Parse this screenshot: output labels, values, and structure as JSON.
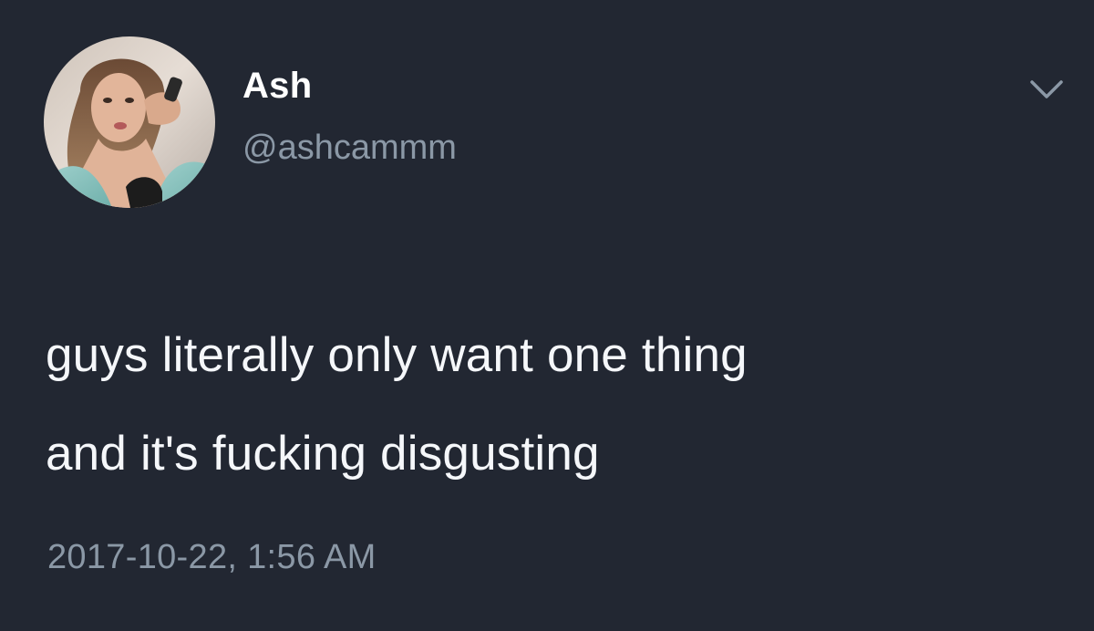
{
  "author": {
    "display_name": "Ash",
    "handle": "@ashcammm",
    "avatar_icon": "profile-photo"
  },
  "tweet": {
    "lines": [
      "guys literally only want one thing",
      "and it's fucking disgusting"
    ],
    "timestamp": "2017-10-22, 1:56 AM"
  },
  "menu": {
    "icon": "chevron-down-icon"
  },
  "colors": {
    "background": "#222732",
    "primary_text": "#f5f7fa",
    "secondary_text": "#8b98a6"
  }
}
